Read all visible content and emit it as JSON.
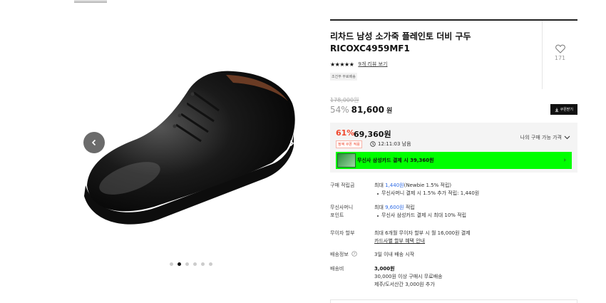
{
  "product": {
    "title": "리차드 남성 소가죽 플레인토 더비 구두 RICOXC4959MF1",
    "rating_stars": "★★★★★",
    "review_link": "9개 리뷰 보기",
    "free_shipping_badge": "조건부 무료배송",
    "like_count": "171"
  },
  "price": {
    "original": "178,000원",
    "discount_rate": "54%",
    "sale_price": "81,600",
    "won": "원",
    "coupon_button": "쿠폰받기"
  },
  "benefit": {
    "discount_rate": "61%",
    "final_price": "69,360원",
    "tag": "정액 쿠폰 적용",
    "timer": "12:11:03 남음",
    "available_label": "나의 구매 가능 가격",
    "card_text": "무신사 삼성카드 결제 시 39,360원"
  },
  "info": {
    "points_label": "구매 적립금",
    "points_max_prefix": "최대 ",
    "points_max_value": "1,440원",
    "points_max_suffix": "(Newbie 1.5% 적립)",
    "points_sub": "무신사머니 결제 시 1.5% 추가 적립: 1,440원",
    "money_label_1": "무신사머니",
    "money_label_2": "포인트",
    "money_prefix": "최대 ",
    "money_value": "9,600원",
    "money_suffix": " 적립",
    "money_sub": "무신사 삼성카드 결제 시 최대 10% 적립",
    "installment_label": "무이자 할부",
    "installment_value": "최대 6개월 무이자 할부 시 월 16,000원 결제",
    "installment_link": "카드사별 할부 혜택 안내",
    "delivery_label": "배송정보",
    "delivery_value": "3일 이내 배송 시작",
    "fee_label": "배송비",
    "fee_value": "3,000원",
    "fee_line2": "30,000원 이상 구매시 무료배송",
    "fee_line3": "제주/도서산간 3,000원 추가"
  },
  "gallery": {
    "dot_count": 6,
    "active_dot": 1
  },
  "colors": {
    "accent_red": "#f0482e",
    "link_blue": "#2e6be6",
    "card_bar": "#00ff00"
  }
}
